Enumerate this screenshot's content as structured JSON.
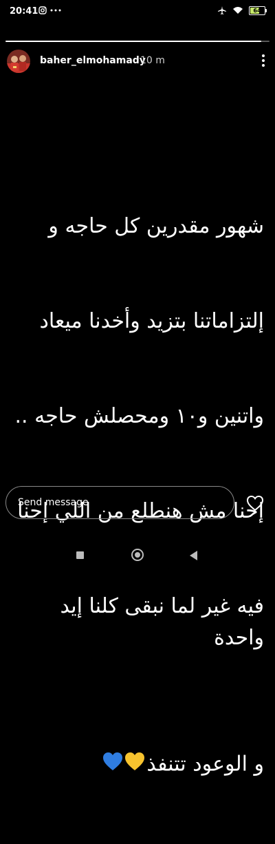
{
  "status_bar": {
    "time": "20:41",
    "icons_left": [
      "instagram-icon",
      "more-dots-icon"
    ],
    "icons_right": [
      "airplane-mode-icon",
      "wifi-icon",
      "battery-icon"
    ],
    "battery_level": "64"
  },
  "story": {
    "progress": 0.97,
    "username": "baher_elmohamady",
    "time_ago": "10 m",
    "caption_lines": [
      "شهور مقدرين كل حاجه و",
      "إلتزاماتنا بتزيد وأخدنا ميعاد",
      "واتنين و١٠ ومحصلش حاجه ..",
      "إحنا مش هنطلع من اللي إحنا",
      "فيه غير لما نبقى كلنا إيد واحدة",
      "و الوعود تتنفذ"
    ],
    "hearts": [
      "💛",
      "💙"
    ]
  },
  "reply": {
    "placeholder": "Send message"
  },
  "colors": {
    "background": "#000000",
    "text": "#ffffff",
    "battery_fill": "#c6e86a",
    "heart_yellow": "#f7c32e",
    "heart_blue": "#2f7de1"
  }
}
